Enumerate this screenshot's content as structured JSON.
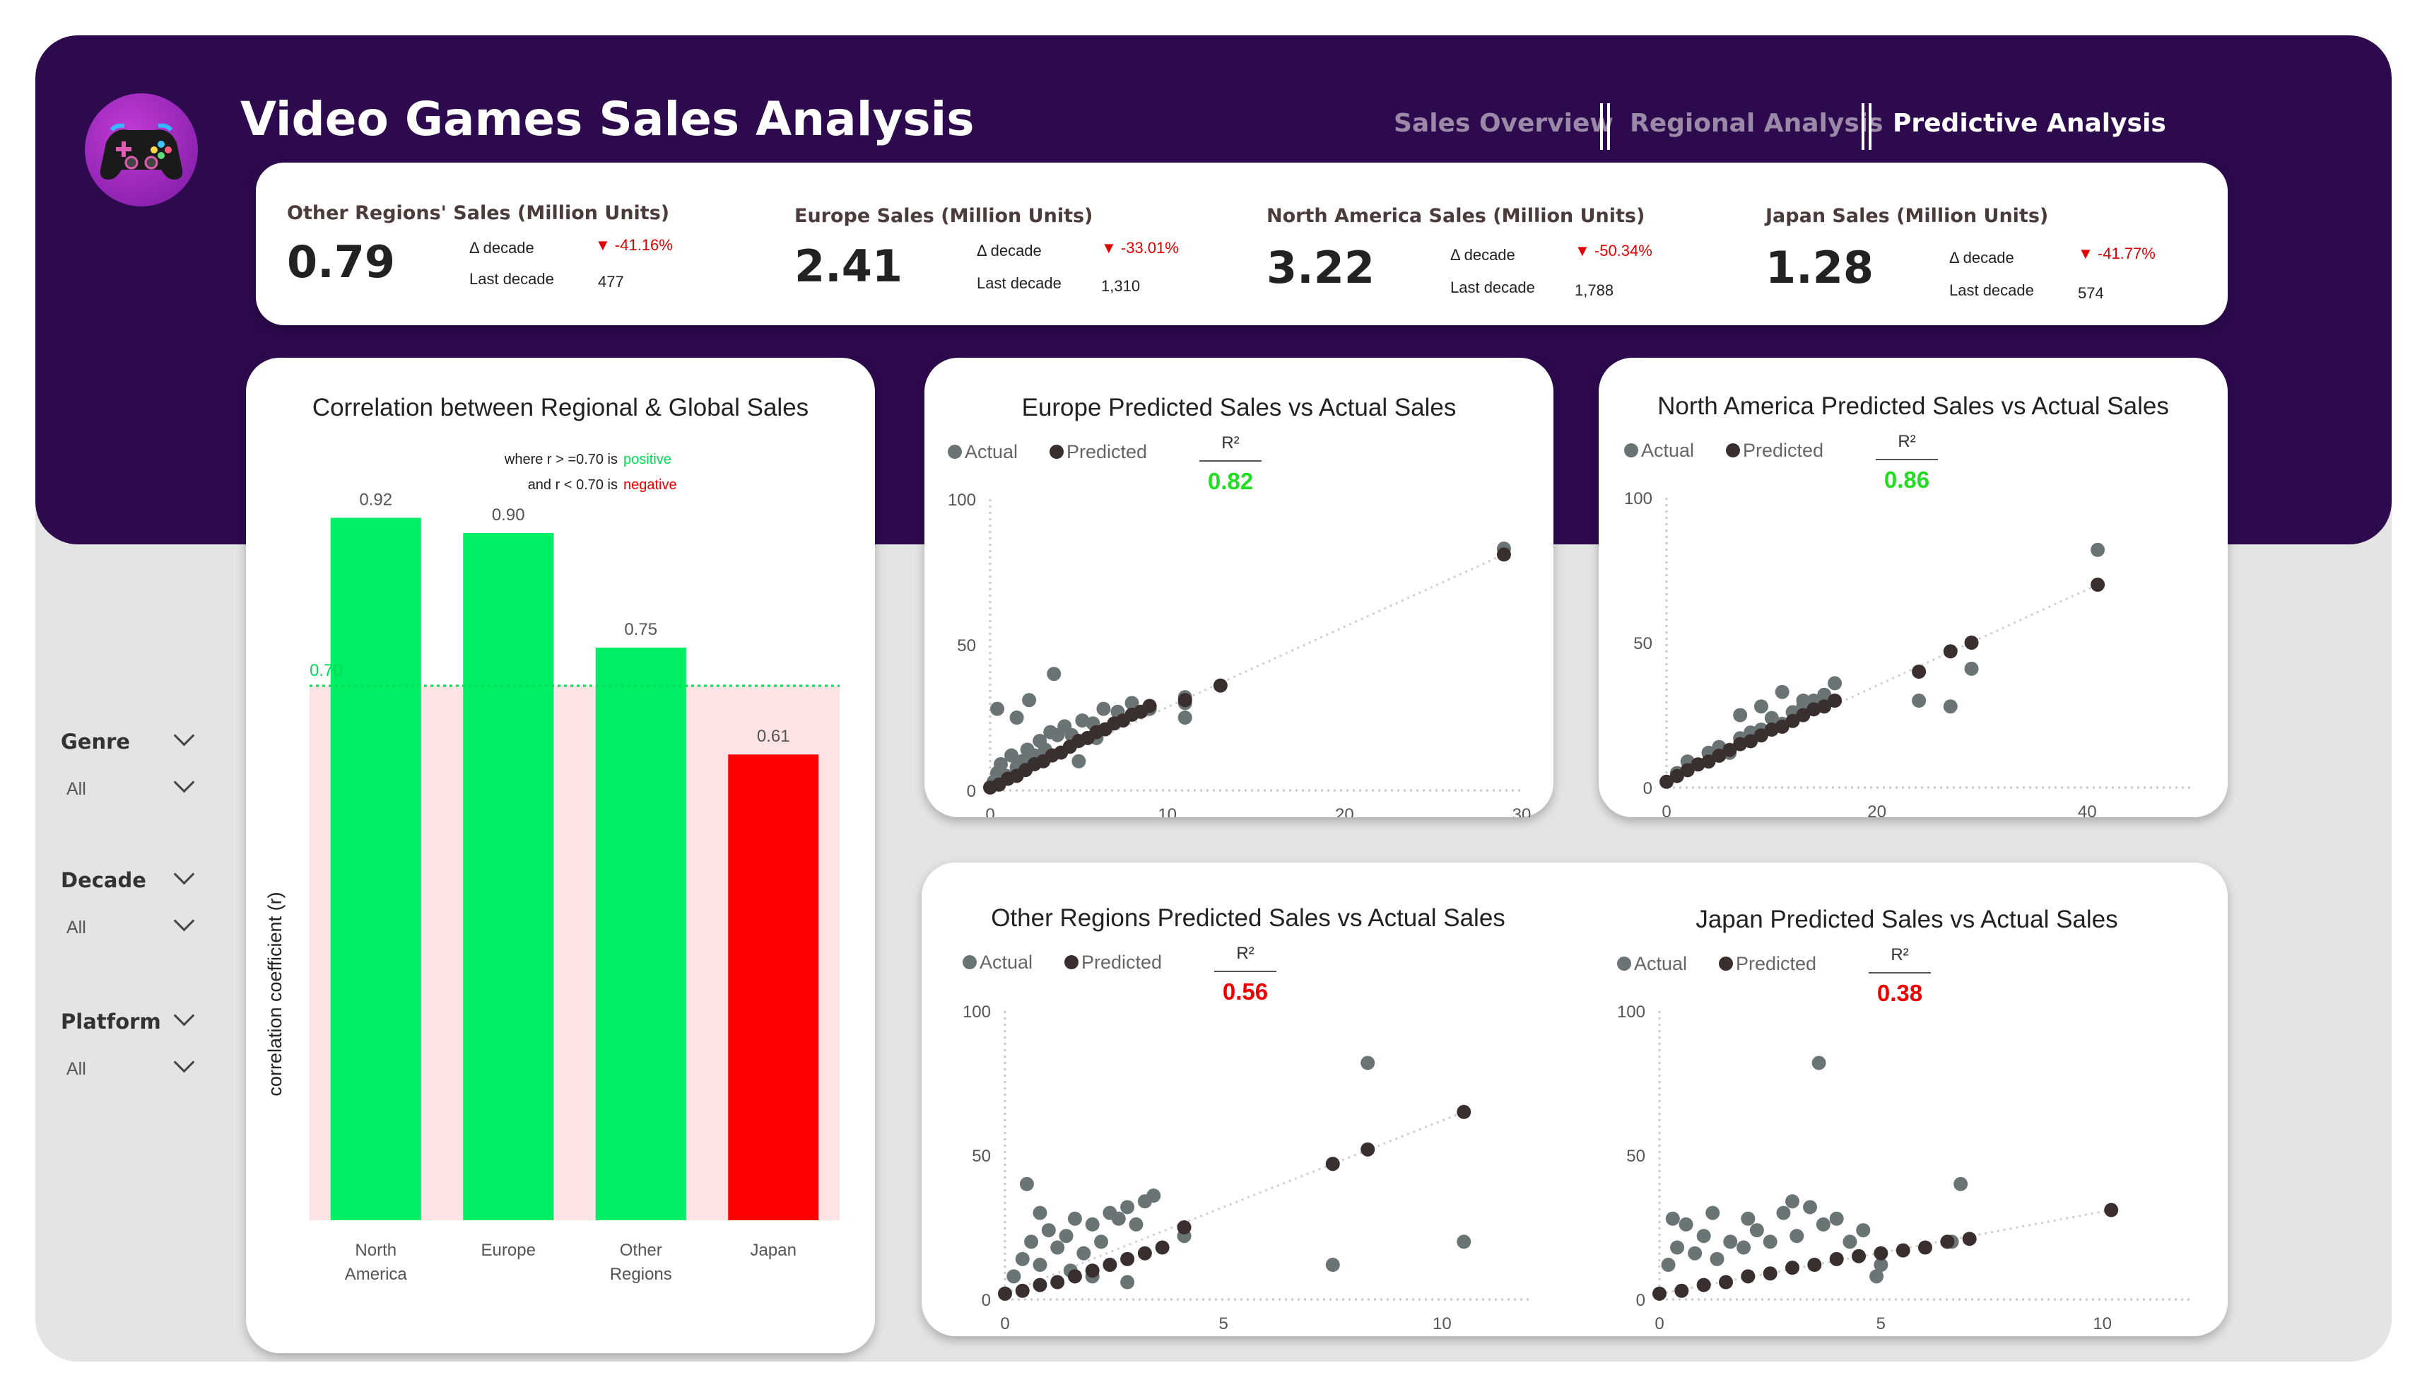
{
  "header": {
    "title": "Video Games Sales Analysis",
    "nav": [
      "Sales Overview",
      "Regional Analysis",
      "Predictive Analysis"
    ],
    "active_nav": "Predictive Analysis",
    "logo_icon": "gamepad-icon"
  },
  "kpis": [
    {
      "label": "Other Regions' Sales (Million Units)",
      "value": "0.79",
      "delta_label": "Δ decade",
      "delta": "▼ -41.16%",
      "last_label": "Last decade",
      "last": "477"
    },
    {
      "label": "Europe Sales (Million Units)",
      "value": "2.41",
      "delta_label": "Δ decade",
      "delta": "▼ -33.01%",
      "last_label": "Last decade",
      "last": "1,310"
    },
    {
      "label": "North America Sales (Million Units)",
      "value": "3.22",
      "delta_label": "Δ decade",
      "delta": "▼ -50.34%",
      "last_label": "Last decade",
      "last": "1,788"
    },
    {
      "label": "Japan Sales (Million Units)",
      "value": "1.28",
      "delta_label": "Δ decade",
      "delta": "▼ -41.77%",
      "last_label": "Last decade",
      "last": "574"
    }
  ],
  "slicers": [
    {
      "label": "Genre",
      "value": "All"
    },
    {
      "label": "Decade",
      "value": "All"
    },
    {
      "label": "Platform",
      "value": "All"
    }
  ],
  "colors": {
    "banner": "#2d0a4e",
    "positive": "#00ee66",
    "negative": "#ff0000",
    "actual": "#6b7475",
    "predicted": "#3a2f2f",
    "delta": "#e00000"
  },
  "chart_data": [
    {
      "type": "bar",
      "title": "Correlation between Regional & Global Sales",
      "ylabel": "correlation coefficient (r)",
      "categories": [
        "North America",
        "Europe",
        "Other Regions",
        "Japan"
      ],
      "values": [
        0.92,
        0.9,
        0.75,
        0.61
      ],
      "value_labels": [
        "0.92",
        "0.90",
        "0.75",
        "0.61"
      ],
      "threshold": 0.7,
      "threshold_label": "0.70",
      "note_line1": "where r > =0.70 is",
      "note_positive": "positive",
      "note_line2": "and r < 0.70 is",
      "note_negative": "negative",
      "ylim": [
        0,
        1
      ]
    },
    {
      "type": "scatter",
      "title": "Europe Predicted Sales vs Actual Sales",
      "legend": [
        "Actual",
        "Predicted"
      ],
      "r2_label": "R²",
      "r2": "0.82",
      "r2_positive": true,
      "xlim": [
        0,
        30
      ],
      "ylim": [
        0,
        100
      ],
      "xticks": [
        0,
        10,
        20,
        30
      ],
      "yticks": [
        0,
        50,
        100
      ],
      "actual": [
        [
          0.2,
          3
        ],
        [
          0.4,
          6
        ],
        [
          0.6,
          9
        ],
        [
          0.9,
          5
        ],
        [
          1.2,
          12
        ],
        [
          1.5,
          8
        ],
        [
          1.8,
          10
        ],
        [
          2.1,
          14
        ],
        [
          2.5,
          12
        ],
        [
          2.8,
          17
        ],
        [
          3.1,
          14
        ],
        [
          3.4,
          20
        ],
        [
          3.8,
          19
        ],
        [
          4.2,
          22
        ],
        [
          4.6,
          19
        ],
        [
          5.2,
          24
        ],
        [
          5.8,
          23
        ],
        [
          6.4,
          28
        ],
        [
          7.2,
          27
        ],
        [
          8.0,
          30
        ],
        [
          9.0,
          28
        ],
        [
          0.4,
          28
        ],
        [
          1.5,
          25
        ],
        [
          2.2,
          31
        ],
        [
          3.6,
          40
        ],
        [
          5,
          10
        ],
        [
          6,
          18
        ],
        [
          11,
          30
        ],
        [
          11,
          25
        ],
        [
          11,
          32
        ],
        [
          29,
          83
        ]
      ],
      "predicted": [
        [
          0,
          1
        ],
        [
          0.5,
          2
        ],
        [
          1,
          4
        ],
        [
          1.5,
          5
        ],
        [
          2,
          7
        ],
        [
          2.5,
          9
        ],
        [
          3,
          10
        ],
        [
          3.5,
          12
        ],
        [
          4,
          13
        ],
        [
          4.5,
          15
        ],
        [
          5,
          17
        ],
        [
          5.5,
          18
        ],
        [
          6,
          20
        ],
        [
          6.5,
          21
        ],
        [
          7,
          23
        ],
        [
          7.5,
          24
        ],
        [
          8,
          26
        ],
        [
          8.5,
          27
        ],
        [
          9,
          29
        ],
        [
          11,
          31
        ],
        [
          13,
          36
        ],
        [
          29,
          81
        ]
      ]
    },
    {
      "type": "scatter",
      "title": "North America Predicted Sales vs Actual Sales",
      "legend": [
        "Actual",
        "Predicted"
      ],
      "r2_label": "R²",
      "r2": "0.86",
      "r2_positive": true,
      "xlim": [
        0,
        50
      ],
      "ylim": [
        0,
        100
      ],
      "xticks": [
        0,
        20,
        40
      ],
      "yticks": [
        0,
        50,
        100
      ],
      "actual": [
        [
          1,
          5
        ],
        [
          2,
          9
        ],
        [
          3,
          8
        ],
        [
          4,
          12
        ],
        [
          5,
          14
        ],
        [
          6,
          12
        ],
        [
          7,
          17
        ],
        [
          8,
          19
        ],
        [
          9,
          20
        ],
        [
          10,
          24
        ],
        [
          11,
          22
        ],
        [
          12,
          26
        ],
        [
          13,
          28
        ],
        [
          14,
          30
        ],
        [
          15,
          32
        ],
        [
          16,
          36
        ],
        [
          7,
          25
        ],
        [
          9,
          28
        ],
        [
          11,
          33
        ],
        [
          13,
          30
        ],
        [
          24,
          30
        ],
        [
          27,
          28
        ],
        [
          29,
          41
        ],
        [
          41,
          82
        ]
      ],
      "predicted": [
        [
          0,
          2
        ],
        [
          1,
          4
        ],
        [
          2,
          6
        ],
        [
          3,
          8
        ],
        [
          4,
          9
        ],
        [
          5,
          11
        ],
        [
          6,
          13
        ],
        [
          7,
          15
        ],
        [
          8,
          16
        ],
        [
          9,
          18
        ],
        [
          10,
          20
        ],
        [
          11,
          21
        ],
        [
          12,
          23
        ],
        [
          13,
          25
        ],
        [
          14,
          27
        ],
        [
          15,
          28
        ],
        [
          16,
          30
        ],
        [
          24,
          40
        ],
        [
          27,
          47
        ],
        [
          29,
          50
        ],
        [
          41,
          70
        ]
      ]
    },
    {
      "type": "scatter",
      "title": "Other Regions Predicted Sales vs Actual Sales",
      "legend": [
        "Actual",
        "Predicted"
      ],
      "r2_label": "R²",
      "r2": "0.56",
      "r2_positive": false,
      "xlim": [
        0,
        12
      ],
      "ylim": [
        0,
        100
      ],
      "xticks": [
        0,
        5,
        10
      ],
      "yticks": [
        0,
        50,
        100
      ],
      "actual": [
        [
          0.2,
          8
        ],
        [
          0.4,
          14
        ],
        [
          0.6,
          20
        ],
        [
          0.8,
          12
        ],
        [
          1.0,
          24
        ],
        [
          1.2,
          18
        ],
        [
          1.4,
          22
        ],
        [
          1.6,
          28
        ],
        [
          1.8,
          16
        ],
        [
          2.0,
          26
        ],
        [
          2.2,
          20
        ],
        [
          2.4,
          30
        ],
        [
          2.6,
          28
        ],
        [
          2.8,
          32
        ],
        [
          3.0,
          26
        ],
        [
          3.2,
          34
        ],
        [
          3.4,
          36
        ],
        [
          0.5,
          40
        ],
        [
          0.8,
          30
        ],
        [
          1.5,
          10
        ],
        [
          2.0,
          8
        ],
        [
          2.8,
          6
        ],
        [
          4.1,
          22
        ],
        [
          7.5,
          12
        ],
        [
          8.3,
          82
        ],
        [
          10.5,
          20
        ]
      ],
      "predicted": [
        [
          0,
          2
        ],
        [
          0.4,
          3
        ],
        [
          0.8,
          5
        ],
        [
          1.2,
          6
        ],
        [
          1.6,
          8
        ],
        [
          2.0,
          10
        ],
        [
          2.4,
          12
        ],
        [
          2.8,
          14
        ],
        [
          3.2,
          16
        ],
        [
          3.6,
          18
        ],
        [
          4.1,
          25
        ],
        [
          7.5,
          47
        ],
        [
          8.3,
          52
        ],
        [
          10.5,
          65
        ]
      ]
    },
    {
      "type": "scatter",
      "title": "Japan Predicted Sales vs Actual Sales",
      "legend": [
        "Actual",
        "Predicted"
      ],
      "r2_label": "R²",
      "r2": "0.38",
      "r2_positive": false,
      "xlim": [
        0,
        12
      ],
      "ylim": [
        0,
        100
      ],
      "xticks": [
        0,
        5,
        10
      ],
      "yticks": [
        0,
        50,
        100
      ],
      "actual": [
        [
          0.2,
          12
        ],
        [
          0.4,
          18
        ],
        [
          0.6,
          26
        ],
        [
          0.8,
          16
        ],
        [
          1.0,
          22
        ],
        [
          1.3,
          14
        ],
        [
          1.6,
          20
        ],
        [
          1.9,
          18
        ],
        [
          2.2,
          24
        ],
        [
          2.5,
          20
        ],
        [
          2.8,
          30
        ],
        [
          3.1,
          22
        ],
        [
          3.4,
          32
        ],
        [
          3.7,
          26
        ],
        [
          4.0,
          28
        ],
        [
          4.3,
          20
        ],
        [
          4.6,
          24
        ],
        [
          0.3,
          28
        ],
        [
          1.2,
          30
        ],
        [
          2.0,
          28
        ],
        [
          3.0,
          34
        ],
        [
          3.6,
          82
        ],
        [
          5.0,
          12
        ],
        [
          6.6,
          20
        ],
        [
          6.8,
          40
        ],
        [
          4.9,
          8
        ]
      ],
      "predicted": [
        [
          0,
          2
        ],
        [
          0.5,
          3
        ],
        [
          1.0,
          5
        ],
        [
          1.5,
          6
        ],
        [
          2.0,
          8
        ],
        [
          2.5,
          9
        ],
        [
          3.0,
          11
        ],
        [
          3.5,
          12
        ],
        [
          4.0,
          14
        ],
        [
          4.5,
          15
        ],
        [
          5.0,
          16
        ],
        [
          5.5,
          17
        ],
        [
          6.0,
          18
        ],
        [
          6.5,
          20
        ],
        [
          7.0,
          21
        ],
        [
          10.2,
          31
        ]
      ]
    }
  ]
}
